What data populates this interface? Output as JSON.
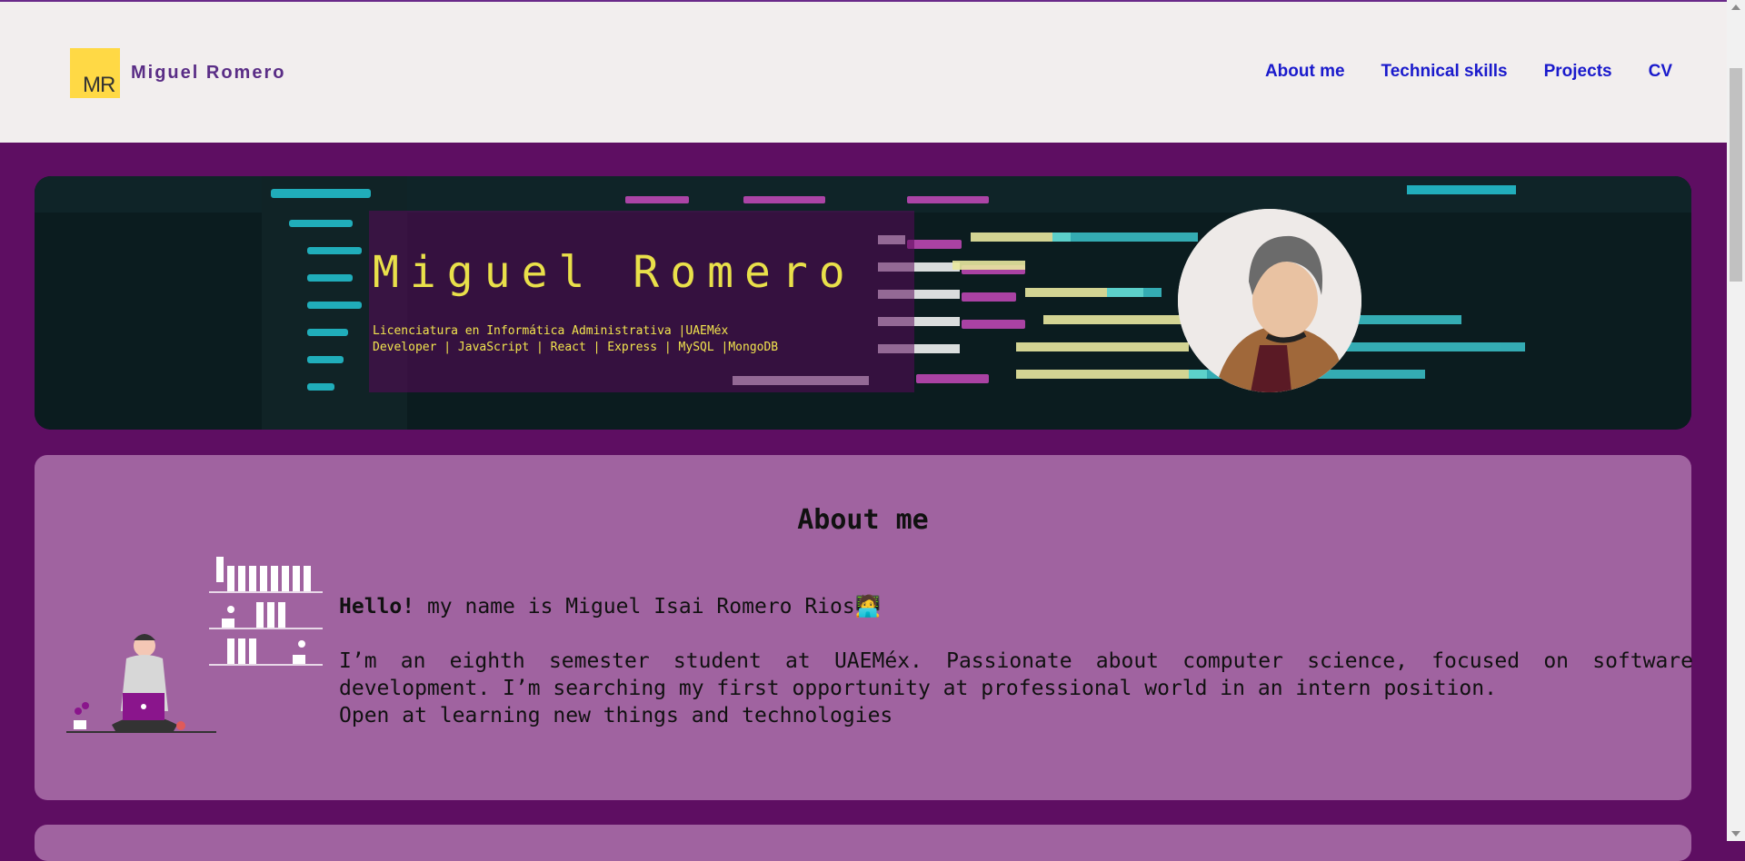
{
  "navbar": {
    "logo_text": "MR",
    "brand_name": "Miguel Romero",
    "links": [
      "About me",
      "Technical skills",
      "Projects",
      "CV"
    ]
  },
  "hero": {
    "title": "Miguel Romero",
    "subtitle_line1": "Licenciatura en Informática Administrativa |UAEMéx",
    "subtitle_line2": "Developer | JavaScript | React | Express | MySQL |MongoDB"
  },
  "about": {
    "title": "About me",
    "hello": "Hello!",
    "intro": " my name is Miguel Isai Romero Rios🧑‍💻",
    "paragraph": "I’m an eighth semester student at UAEMéx. Passionate about computer science, focused on software development. I’m searching my first opportunity at professional world in an intern position.",
    "closing": "Open at learning new things and technologies"
  },
  "colors": {
    "page_bg": "#5e0e62",
    "navbar_bg": "#f2eeee",
    "card_bg": "#a063a0",
    "nav_link": "#1a1acc",
    "brand": "#5a2d86",
    "logo_bg": "#ffd945",
    "hero_title": "#e9e04a"
  }
}
